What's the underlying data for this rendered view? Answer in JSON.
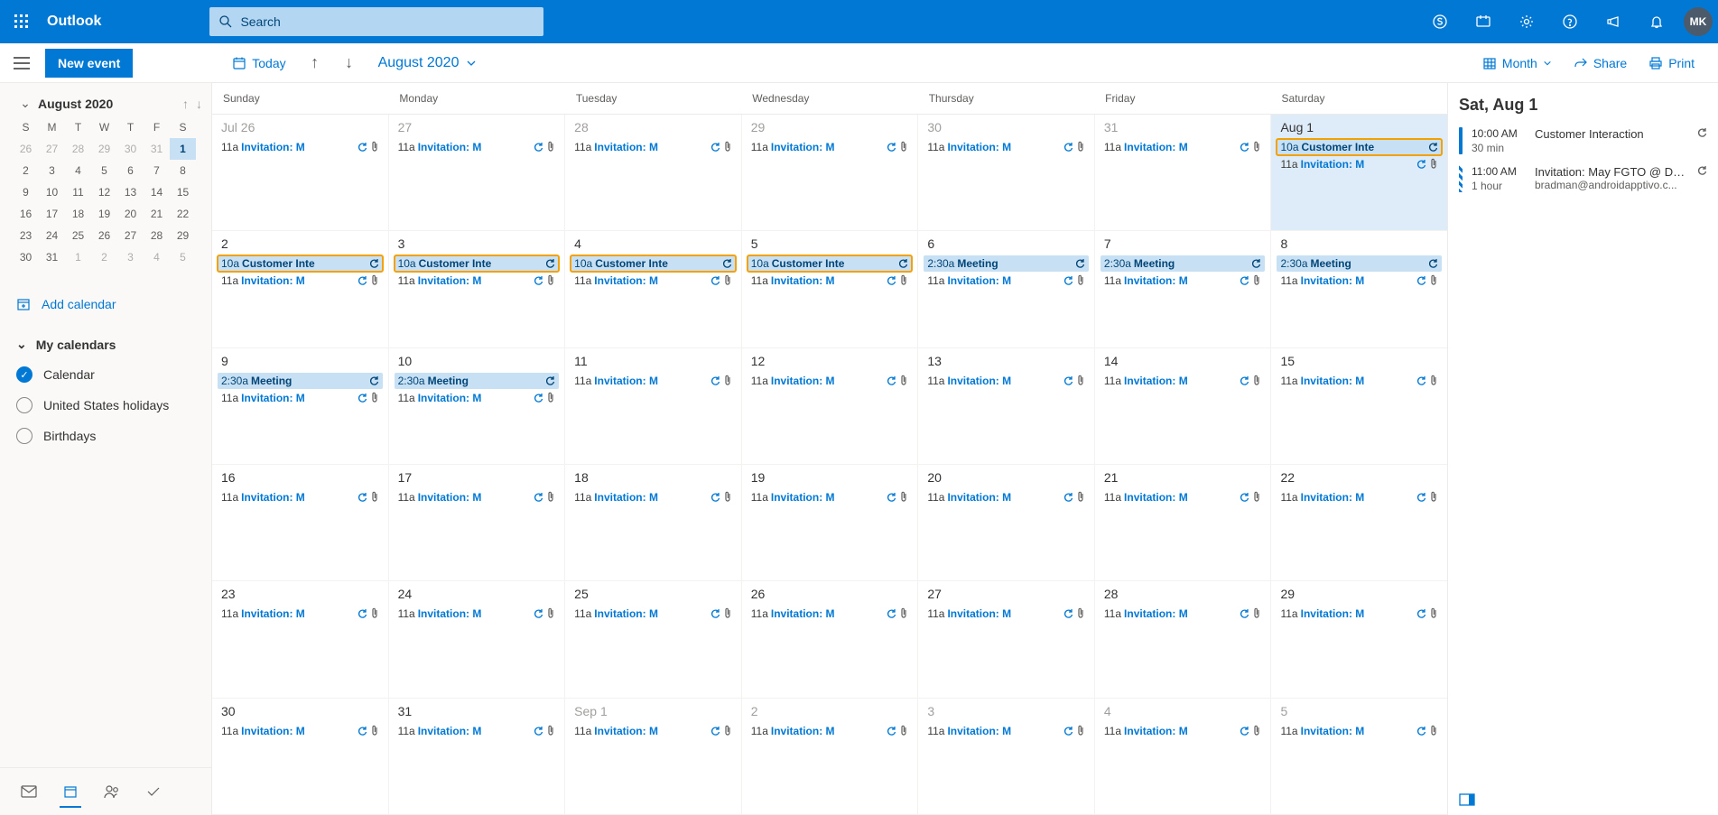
{
  "header": {
    "brand": "Outlook",
    "search_placeholder": "Search",
    "avatar_initials": "MK"
  },
  "cmdbar": {
    "new_event": "New event",
    "today": "Today",
    "month_label": "August 2020",
    "view_label": "Month",
    "share": "Share",
    "print": "Print"
  },
  "mini": {
    "title": "August 2020",
    "dows": [
      "S",
      "M",
      "T",
      "W",
      "T",
      "F",
      "S"
    ],
    "rows": [
      [
        {
          "n": "26",
          "dim": true
        },
        {
          "n": "27",
          "dim": true
        },
        {
          "n": "28",
          "dim": true
        },
        {
          "n": "29",
          "dim": true
        },
        {
          "n": "30",
          "dim": true
        },
        {
          "n": "31",
          "dim": true
        },
        {
          "n": "1",
          "sel": true
        }
      ],
      [
        {
          "n": "2"
        },
        {
          "n": "3"
        },
        {
          "n": "4"
        },
        {
          "n": "5"
        },
        {
          "n": "6"
        },
        {
          "n": "7"
        },
        {
          "n": "8"
        }
      ],
      [
        {
          "n": "9"
        },
        {
          "n": "10"
        },
        {
          "n": "11"
        },
        {
          "n": "12"
        },
        {
          "n": "13"
        },
        {
          "n": "14"
        },
        {
          "n": "15"
        }
      ],
      [
        {
          "n": "16"
        },
        {
          "n": "17"
        },
        {
          "n": "18"
        },
        {
          "n": "19"
        },
        {
          "n": "20"
        },
        {
          "n": "21"
        },
        {
          "n": "22"
        }
      ],
      [
        {
          "n": "23"
        },
        {
          "n": "24"
        },
        {
          "n": "25"
        },
        {
          "n": "26"
        },
        {
          "n": "27"
        },
        {
          "n": "28"
        },
        {
          "n": "29"
        }
      ],
      [
        {
          "n": "30"
        },
        {
          "n": "31"
        },
        {
          "n": "1",
          "dim": true
        },
        {
          "n": "2",
          "dim": true
        },
        {
          "n": "3",
          "dim": true
        },
        {
          "n": "4",
          "dim": true
        },
        {
          "n": "5",
          "dim": true
        }
      ]
    ]
  },
  "sidebar": {
    "add_calendar": "Add calendar",
    "my_calendars": "My calendars",
    "calendars": [
      {
        "name": "Calendar",
        "checked": true
      },
      {
        "name": "United States holidays",
        "checked": false
      },
      {
        "name": "Birthdays",
        "checked": false
      }
    ]
  },
  "grid": {
    "dows": [
      "Sunday",
      "Monday",
      "Tuesday",
      "Wednesday",
      "Thursday",
      "Friday",
      "Saturday"
    ],
    "weeks": [
      [
        {
          "label": "Jul 26",
          "dim": true,
          "events": [
            {
              "type": "invite",
              "time": "11a",
              "title": "Invitation: M"
            }
          ]
        },
        {
          "label": "27",
          "dim": true,
          "events": [
            {
              "type": "invite",
              "time": "11a",
              "title": "Invitation: M"
            }
          ]
        },
        {
          "label": "28",
          "dim": true,
          "events": [
            {
              "type": "invite",
              "time": "11a",
              "title": "Invitation: M"
            }
          ]
        },
        {
          "label": "29",
          "dim": true,
          "events": [
            {
              "type": "invite",
              "time": "11a",
              "title": "Invitation: M"
            }
          ]
        },
        {
          "label": "30",
          "dim": true,
          "events": [
            {
              "type": "invite",
              "time": "11a",
              "title": "Invitation: M"
            }
          ]
        },
        {
          "label": "31",
          "dim": true,
          "events": [
            {
              "type": "invite",
              "time": "11a",
              "title": "Invitation: M"
            }
          ]
        },
        {
          "label": "Aug 1",
          "sel": true,
          "events": [
            {
              "type": "chip",
              "time": "10a",
              "title": "Customer Inte",
              "orange": true
            },
            {
              "type": "invite",
              "time": "11a",
              "title": "Invitation: M"
            }
          ]
        }
      ],
      [
        {
          "label": "2",
          "events": [
            {
              "type": "chip",
              "time": "10a",
              "title": "Customer Inte",
              "orange": true
            },
            {
              "type": "invite",
              "time": "11a",
              "title": "Invitation: M"
            }
          ]
        },
        {
          "label": "3",
          "events": [
            {
              "type": "chip",
              "time": "10a",
              "title": "Customer Inte",
              "orange": true
            },
            {
              "type": "invite",
              "time": "11a",
              "title": "Invitation: M"
            }
          ]
        },
        {
          "label": "4",
          "events": [
            {
              "type": "chip",
              "time": "10a",
              "title": "Customer Inte",
              "orange": true
            },
            {
              "type": "invite",
              "time": "11a",
              "title": "Invitation: M"
            }
          ]
        },
        {
          "label": "5",
          "events": [
            {
              "type": "chip",
              "time": "10a",
              "title": "Customer Inte",
              "orange": true
            },
            {
              "type": "invite",
              "time": "11a",
              "title": "Invitation: M"
            }
          ]
        },
        {
          "label": "6",
          "events": [
            {
              "type": "chip",
              "time": "2:30a",
              "title": "Meeting"
            },
            {
              "type": "invite",
              "time": "11a",
              "title": "Invitation: M"
            }
          ]
        },
        {
          "label": "7",
          "events": [
            {
              "type": "chip",
              "time": "2:30a",
              "title": "Meeting"
            },
            {
              "type": "invite",
              "time": "11a",
              "title": "Invitation: M"
            }
          ]
        },
        {
          "label": "8",
          "events": [
            {
              "type": "chip",
              "time": "2:30a",
              "title": "Meeting"
            },
            {
              "type": "invite",
              "time": "11a",
              "title": "Invitation: M"
            }
          ]
        }
      ],
      [
        {
          "label": "9",
          "events": [
            {
              "type": "chip",
              "time": "2:30a",
              "title": "Meeting"
            },
            {
              "type": "invite",
              "time": "11a",
              "title": "Invitation: M"
            }
          ]
        },
        {
          "label": "10",
          "events": [
            {
              "type": "chip",
              "time": "2:30a",
              "title": "Meeting"
            },
            {
              "type": "invite",
              "time": "11a",
              "title": "Invitation: M"
            }
          ]
        },
        {
          "label": "11",
          "events": [
            {
              "type": "invite",
              "time": "11a",
              "title": "Invitation: M"
            }
          ]
        },
        {
          "label": "12",
          "events": [
            {
              "type": "invite",
              "time": "11a",
              "title": "Invitation: M"
            }
          ]
        },
        {
          "label": "13",
          "events": [
            {
              "type": "invite",
              "time": "11a",
              "title": "Invitation: M"
            }
          ]
        },
        {
          "label": "14",
          "events": [
            {
              "type": "invite",
              "time": "11a",
              "title": "Invitation: M"
            }
          ]
        },
        {
          "label": "15",
          "events": [
            {
              "type": "invite",
              "time": "11a",
              "title": "Invitation: M"
            }
          ]
        }
      ],
      [
        {
          "label": "16",
          "events": [
            {
              "type": "invite",
              "time": "11a",
              "title": "Invitation: M"
            }
          ]
        },
        {
          "label": "17",
          "events": [
            {
              "type": "invite",
              "time": "11a",
              "title": "Invitation: M"
            }
          ]
        },
        {
          "label": "18",
          "events": [
            {
              "type": "invite",
              "time": "11a",
              "title": "Invitation: M"
            }
          ]
        },
        {
          "label": "19",
          "events": [
            {
              "type": "invite",
              "time": "11a",
              "title": "Invitation: M"
            }
          ]
        },
        {
          "label": "20",
          "events": [
            {
              "type": "invite",
              "time": "11a",
              "title": "Invitation: M"
            }
          ]
        },
        {
          "label": "21",
          "events": [
            {
              "type": "invite",
              "time": "11a",
              "title": "Invitation: M"
            }
          ]
        },
        {
          "label": "22",
          "events": [
            {
              "type": "invite",
              "time": "11a",
              "title": "Invitation: M"
            }
          ]
        }
      ],
      [
        {
          "label": "23",
          "events": [
            {
              "type": "invite",
              "time": "11a",
              "title": "Invitation: M"
            }
          ]
        },
        {
          "label": "24",
          "events": [
            {
              "type": "invite",
              "time": "11a",
              "title": "Invitation: M"
            }
          ]
        },
        {
          "label": "25",
          "events": [
            {
              "type": "invite",
              "time": "11a",
              "title": "Invitation: M"
            }
          ]
        },
        {
          "label": "26",
          "events": [
            {
              "type": "invite",
              "time": "11a",
              "title": "Invitation: M"
            }
          ]
        },
        {
          "label": "27",
          "events": [
            {
              "type": "invite",
              "time": "11a",
              "title": "Invitation: M"
            }
          ]
        },
        {
          "label": "28",
          "events": [
            {
              "type": "invite",
              "time": "11a",
              "title": "Invitation: M"
            }
          ]
        },
        {
          "label": "29",
          "events": [
            {
              "type": "invite",
              "time": "11a",
              "title": "Invitation: M"
            }
          ]
        }
      ],
      [
        {
          "label": "30",
          "events": [
            {
              "type": "invite",
              "time": "11a",
              "title": "Invitation: M"
            }
          ]
        },
        {
          "label": "31",
          "events": [
            {
              "type": "invite",
              "time": "11a",
              "title": "Invitation: M"
            }
          ]
        },
        {
          "label": "Sep 1",
          "dim": true,
          "events": [
            {
              "type": "invite",
              "time": "11a",
              "title": "Invitation: M"
            }
          ]
        },
        {
          "label": "2",
          "dim": true,
          "events": [
            {
              "type": "invite",
              "time": "11a",
              "title": "Invitation: M"
            }
          ]
        },
        {
          "label": "3",
          "dim": true,
          "events": [
            {
              "type": "invite",
              "time": "11a",
              "title": "Invitation: M"
            }
          ]
        },
        {
          "label": "4",
          "dim": true,
          "events": [
            {
              "type": "invite",
              "time": "11a",
              "title": "Invitation: M"
            }
          ]
        },
        {
          "label": "5",
          "dim": true,
          "events": [
            {
              "type": "invite",
              "time": "11a",
              "title": "Invitation: M"
            }
          ]
        }
      ]
    ]
  },
  "agenda": {
    "title": "Sat, Aug 1",
    "items": [
      {
        "bar": "solid",
        "time": "10:00 AM",
        "dur": "30 min",
        "title": "Customer Interaction",
        "sub": ""
      },
      {
        "bar": "striped",
        "time": "11:00 AM",
        "dur": "1 hour",
        "title": "Invitation: May FGTO @ Daily...",
        "sub": "bradman@androidapptivo.c..."
      }
    ]
  }
}
